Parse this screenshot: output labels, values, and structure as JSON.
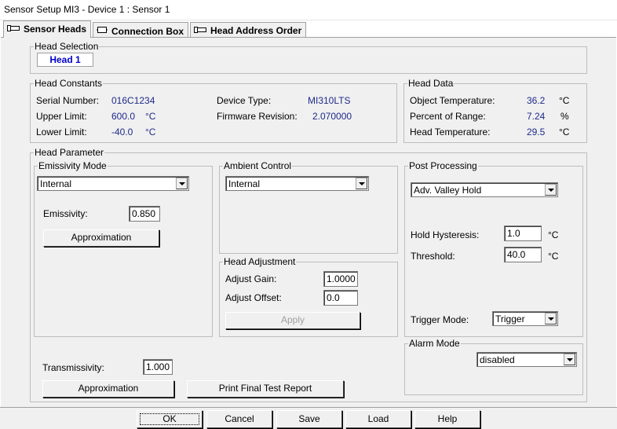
{
  "window": {
    "title": "Sensor Setup MI3 - Device 1 : Sensor 1"
  },
  "tabs": [
    {
      "label": "Sensor Heads",
      "icon": "sensor-head-icon"
    },
    {
      "label": "Connection Box",
      "icon": "connection-box-icon"
    },
    {
      "label": "Head Address Order",
      "icon": "head-address-icon"
    }
  ],
  "head_selection": {
    "legend": "Head Selection",
    "selected": "Head 1"
  },
  "head_constants": {
    "legend": "Head Constants",
    "serial_label": "Serial Number:",
    "serial_value": "016C1234",
    "upper_label": "Upper Limit:",
    "upper_value": "600.0",
    "upper_unit": "°C",
    "lower_label": "Lower Limit:",
    "lower_value": "-40.0",
    "lower_unit": "°C",
    "device_type_label": "Device Type:",
    "device_type_value": "MI310LTS",
    "firmware_label": "Firmware Revision:",
    "firmware_value": "2.070000"
  },
  "head_data": {
    "legend": "Head Data",
    "object_temp_label": "Object Temperature:",
    "object_temp_value": "36.2",
    "object_temp_unit": "°C",
    "percent_range_label": "Percent of Range:",
    "percent_range_value": "7.24",
    "percent_range_unit": "%",
    "head_temp_label": "Head Temperature:",
    "head_temp_value": "29.5",
    "head_temp_unit": "°C"
  },
  "head_parameter": {
    "legend": "Head Parameter",
    "emissivity_mode": {
      "legend": "Emissivity Mode",
      "selected": "Internal",
      "emissivity_label": "Emissivity:",
      "emissivity_value": "0.850",
      "approx_button": "Approximation"
    },
    "ambient_control": {
      "legend": "Ambient Control",
      "selected": "Internal"
    },
    "head_adjustment": {
      "legend": "Head Adjustment",
      "gain_label": "Adjust Gain:",
      "gain_value": "1.0000",
      "offset_label": "Adjust Offset:",
      "offset_value": "0.0",
      "apply_button": "Apply"
    },
    "post_processing": {
      "legend": "Post Processing",
      "selected": "Adv. Valley Hold",
      "hysteresis_label": "Hold Hysteresis:",
      "hysteresis_value": "1.0",
      "hysteresis_unit": "°C",
      "threshold_label": "Threshold:",
      "threshold_value": "40.0",
      "threshold_unit": "°C",
      "trigger_label": "Trigger Mode:",
      "trigger_selected": "Trigger"
    },
    "alarm_mode": {
      "legend": "Alarm Mode",
      "selected": "disabled"
    },
    "transmissivity_label": "Transmissivity:",
    "transmissivity_value": "1.000",
    "approx_button": "Approximation",
    "print_button": "Print Final Test Report"
  },
  "footer": {
    "ok": "OK",
    "cancel": "Cancel",
    "save": "Save",
    "load": "Load",
    "help": "Help"
  }
}
